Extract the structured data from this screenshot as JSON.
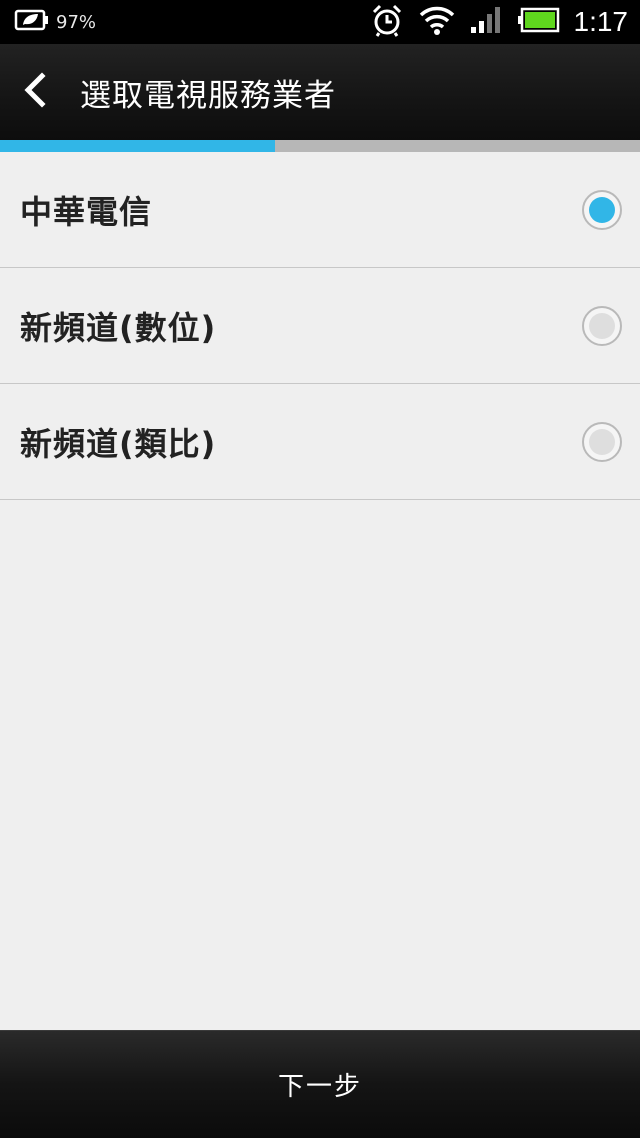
{
  "status_bar": {
    "battery_percent": "97%",
    "time": "1:17",
    "icons": [
      "power-saver-icon",
      "alarm-icon",
      "wifi-icon",
      "signal-icon",
      "battery-icon"
    ]
  },
  "title_bar": {
    "title": "選取電視服務業者",
    "back_icon": "chevron-left-icon"
  },
  "progress": {
    "value": 0.43,
    "color": "#31b6e7",
    "track": "#b7b7b7"
  },
  "options": [
    {
      "label": "中華電信",
      "checked": true
    },
    {
      "label": "新頻道(數位)",
      "checked": false
    },
    {
      "label": "新頻道(類比)",
      "checked": false
    }
  ],
  "footer": {
    "next_label": "下一步"
  },
  "colors": {
    "accent": "#31b6e7",
    "background": "#efefef"
  }
}
